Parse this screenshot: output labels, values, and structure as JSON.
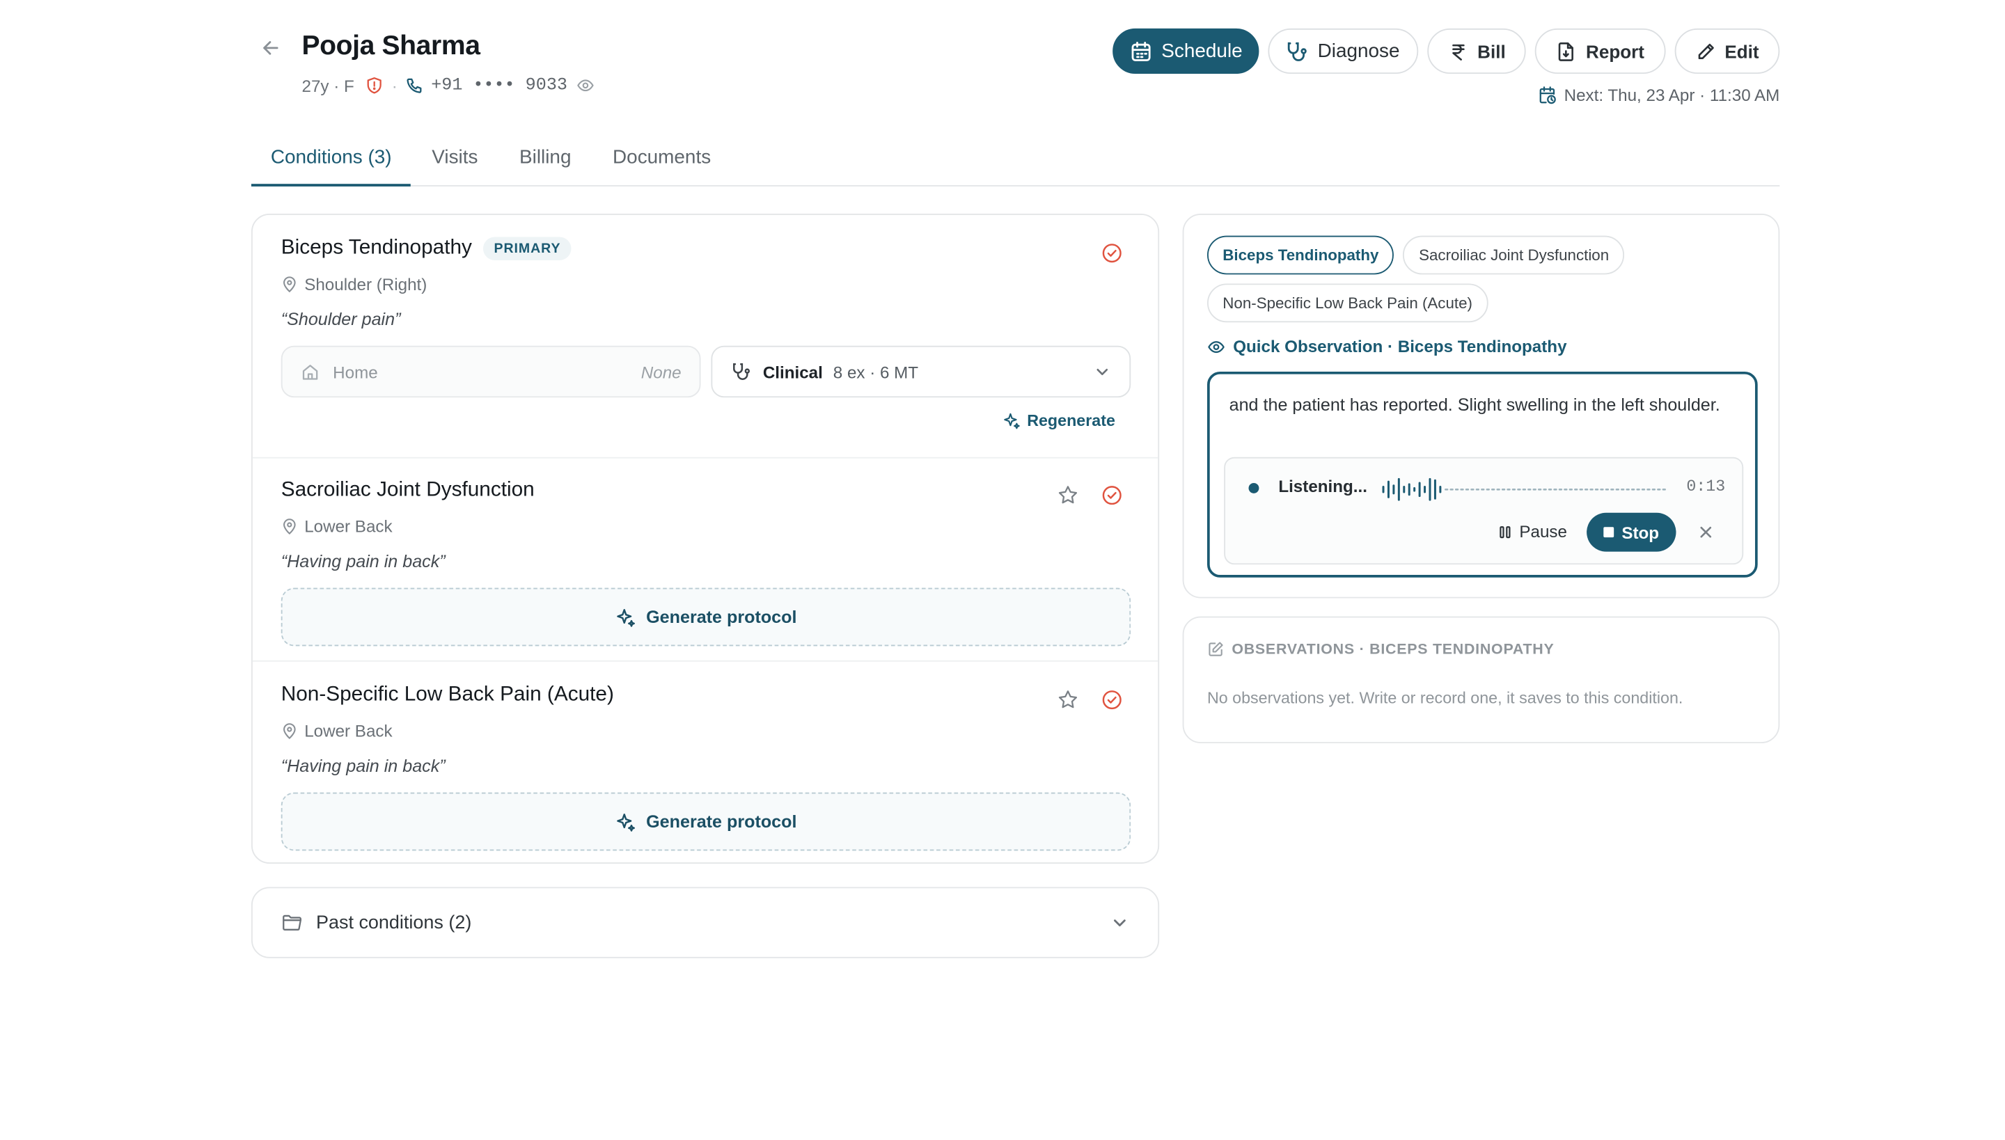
{
  "patient": {
    "name": "Pooja Sharma",
    "age_sex": "27y · F",
    "phone_prefix": "+91",
    "phone_masked": "•••• 9033"
  },
  "actions": {
    "schedule": "Schedule",
    "diagnose": "Diagnose",
    "bill": "Bill",
    "report": "Report",
    "edit": "Edit"
  },
  "next_appointment": "Next: Thu, 23 Apr · 11:30 AM",
  "tabs": [
    {
      "label": "Conditions (3)",
      "active": true
    },
    {
      "label": "Visits",
      "active": false
    },
    {
      "label": "Billing",
      "active": false
    },
    {
      "label": "Documents",
      "active": false
    }
  ],
  "conditions": [
    {
      "title": "Biceps Tendinopathy",
      "badge": "PRIMARY",
      "location": "Shoulder (Right)",
      "quote": "“Shoulder pain”",
      "home": {
        "label": "Home",
        "value": "None"
      },
      "clinical": {
        "label": "Clinical",
        "detail": "8 ex · 6 MT"
      },
      "regenerate": "Regenerate"
    },
    {
      "title": "Sacroiliac Joint Dysfunction",
      "location": "Lower Back",
      "quote": "“Having pain in back”",
      "action": "Generate protocol"
    },
    {
      "title": "Non-Specific Low Back Pain (Acute)",
      "location": "Lower Back",
      "quote": "“Having pain in back”",
      "action": "Generate protocol"
    }
  ],
  "past_conditions": "Past conditions (2)",
  "observation_panel": {
    "chips": [
      {
        "label": "Biceps Tendinopathy",
        "active": true
      },
      {
        "label": "Sacroiliac Joint Dysfunction",
        "active": false
      },
      {
        "label": "Non-Specific Low Back Pain (Acute)",
        "active": false
      }
    ],
    "quick_title": "Quick Observation · Biceps Tendinopathy",
    "note_text": "and the patient has reported. Slight swelling in the left shoulder.",
    "recorder": {
      "status": "Listening...",
      "timer": "0:13",
      "pause": "Pause",
      "stop": "Stop"
    }
  },
  "observations": {
    "heading": "OBSERVATIONS · BICEPS TENDINOPATHY",
    "empty_text": "No observations yet. Write or record one, it saves to this condition."
  },
  "colors": {
    "accent": "#1b5a72",
    "alert": "#e0533f"
  }
}
